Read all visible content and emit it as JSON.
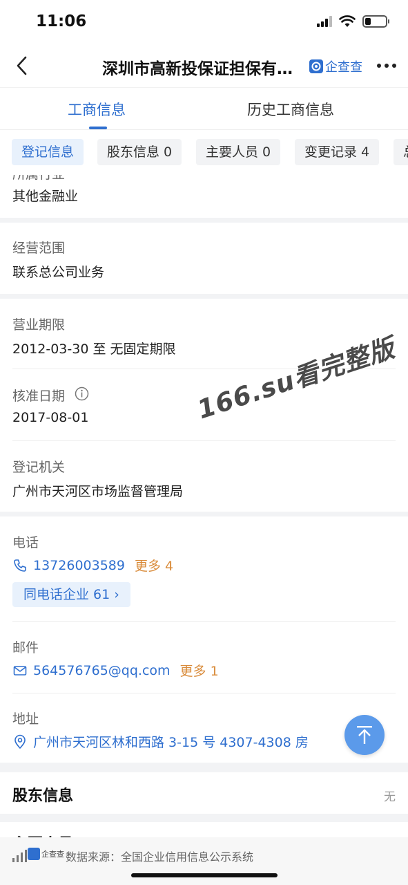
{
  "status_bar": {
    "time": "11:06"
  },
  "nav": {
    "title": "深圳市高新投保证担保有…",
    "brand": "企查查"
  },
  "tabs": [
    {
      "label": "工商信息",
      "active": true
    },
    {
      "label": "历史工商信息",
      "active": false
    }
  ],
  "chips": [
    {
      "label": "登记信息",
      "active": true
    },
    {
      "label": "股东信息 0",
      "active": false
    },
    {
      "label": "主要人员 0",
      "active": false
    },
    {
      "label": "变更记录 4",
      "active": false
    },
    {
      "label": "总",
      "active": false
    }
  ],
  "fields": {
    "industry_partial_label": "所属行业",
    "industry_value": "其他金融业",
    "scope_label": "经营范围",
    "scope_value": "联系总公司业务",
    "term_label": "营业期限",
    "term_value": "2012-03-30 至 无固定期限",
    "approval_label": "核准日期",
    "approval_value": "2017-08-01",
    "authority_label": "登记机关",
    "authority_value": "广州市天河区市场监督管理局",
    "phone_label": "电话",
    "phone_value": "13726003589",
    "phone_more": "更多 4",
    "same_phone_label": "同电话企业 61 ›",
    "email_label": "邮件",
    "email_value": "564576765@qq.com",
    "email_more": "更多 1",
    "address_label": "地址",
    "address_value": "广州市天河区林和西路 3-15 号 4307-4308 房"
  },
  "watermark": "166.su看完整版",
  "shareholder_section": {
    "title": "股东信息",
    "empty": "无"
  },
  "next_section_partial": "主要人员",
  "footer": {
    "logo_text": "企查查",
    "source_text": "数据来源：全国企业信用信息公示系统"
  },
  "colors": {
    "accent": "#2f6fcf",
    "more_orange": "#d98b3a",
    "chip_active_bg": "#e8f1fc",
    "band_gray": "#f2f3f5"
  }
}
